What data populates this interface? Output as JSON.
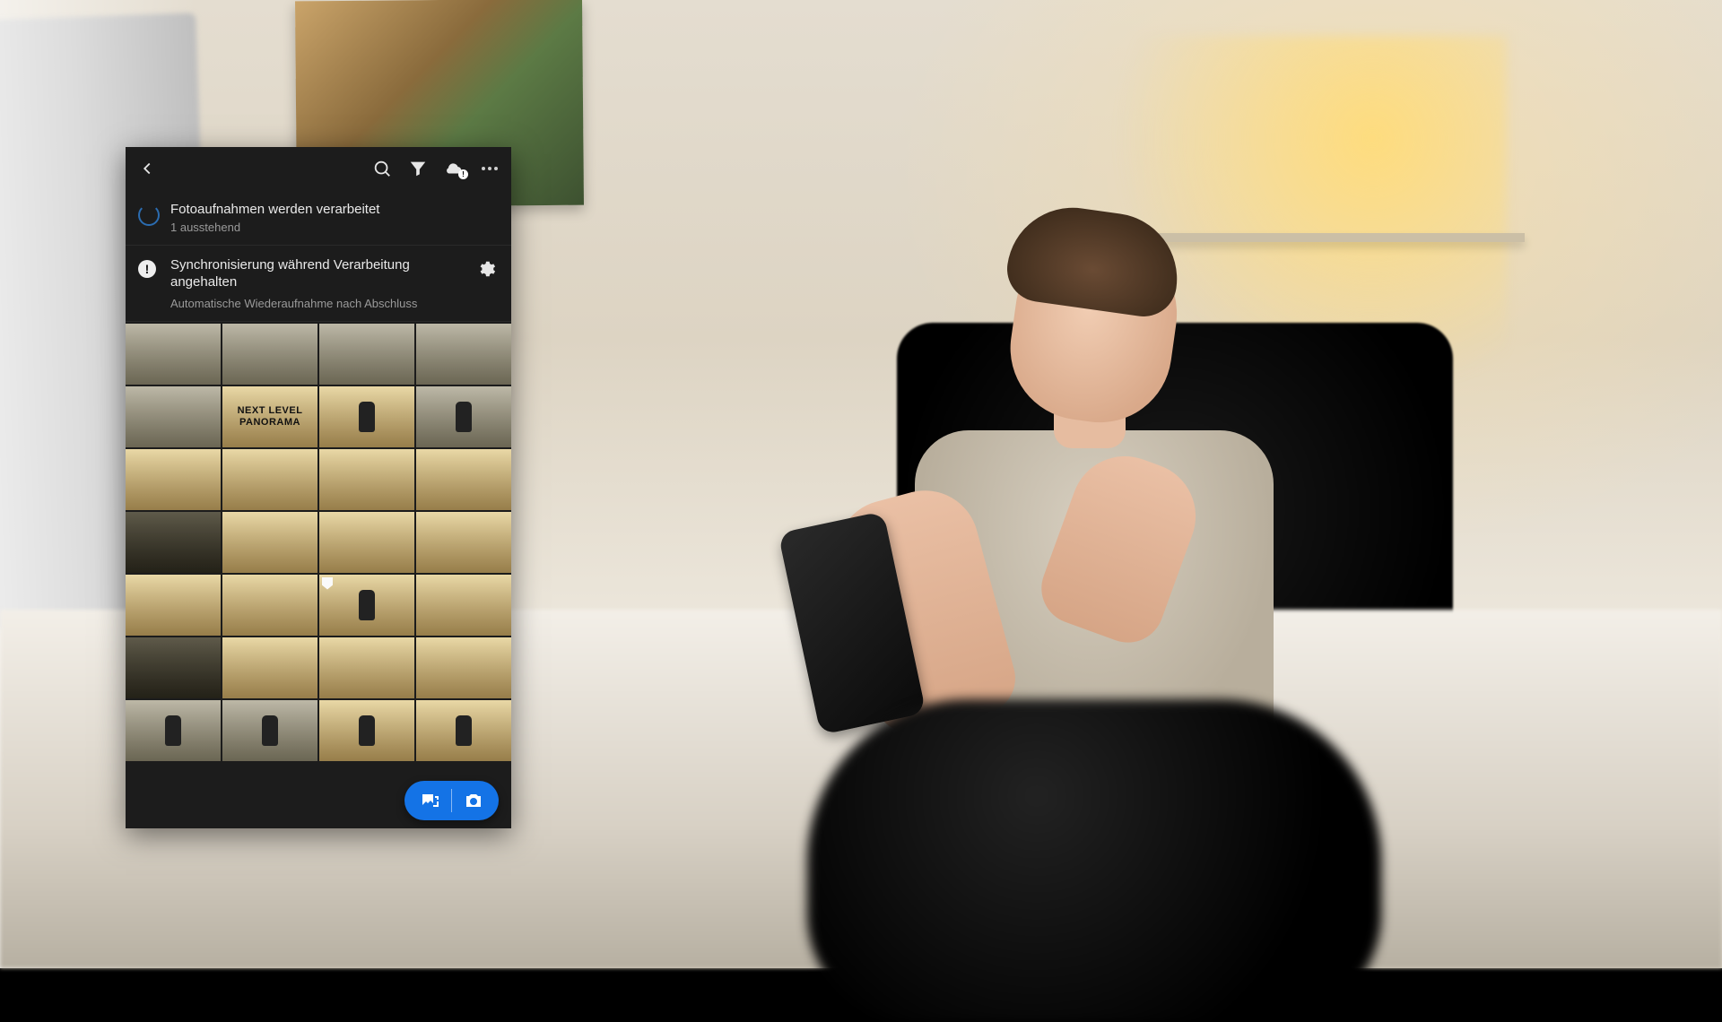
{
  "topbar": {
    "back_icon": "chevron-left",
    "search_icon": "magnifier",
    "filter_icon": "funnel",
    "cloud_icon": "cloud",
    "cloud_badge": "!",
    "more_icon": "more-horizontal"
  },
  "notifications": [
    {
      "icon": "spinner",
      "title": "Fotoaufnahmen werden verarbeitet",
      "subtitle": "1 ausstehend"
    },
    {
      "icon": "warning",
      "title": "Synchronisierung während Verarbeitung angehalten",
      "note": "Automatische Wiederaufnahme nach Abschluss",
      "action_icon": "gear"
    }
  ],
  "grid": {
    "rows": 7,
    "cols": 4,
    "tiles": [
      {
        "tone": "cool"
      },
      {
        "tone": "cool"
      },
      {
        "tone": "cool"
      },
      {
        "tone": "cool"
      },
      {
        "tone": "cool"
      },
      {
        "tone": "warm",
        "label": "NEXT LEVEL\nPANORAMA"
      },
      {
        "tone": "warm",
        "person": true
      },
      {
        "tone": "cool",
        "person": true
      },
      {
        "tone": "warm"
      },
      {
        "tone": "warm"
      },
      {
        "tone": "warm"
      },
      {
        "tone": "warm"
      },
      {
        "tone": "dark"
      },
      {
        "tone": "warm"
      },
      {
        "tone": "warm"
      },
      {
        "tone": "warm"
      },
      {
        "tone": "warm"
      },
      {
        "tone": "warm"
      },
      {
        "tone": "warm",
        "flag": true,
        "person": true
      },
      {
        "tone": "warm"
      },
      {
        "tone": "dark"
      },
      {
        "tone": "warm"
      },
      {
        "tone": "warm"
      },
      {
        "tone": "warm"
      },
      {
        "tone": "cool",
        "person": true
      },
      {
        "tone": "cool",
        "person": true
      },
      {
        "tone": "warm",
        "person": true
      },
      {
        "tone": "warm",
        "person": true
      }
    ]
  },
  "fab": {
    "import_icon": "add-photo",
    "camera_icon": "camera"
  },
  "colors": {
    "accent": "#1473e6",
    "bg": "#1c1c1c",
    "text": "#eaeaea",
    "muted": "#9a9a9a"
  }
}
